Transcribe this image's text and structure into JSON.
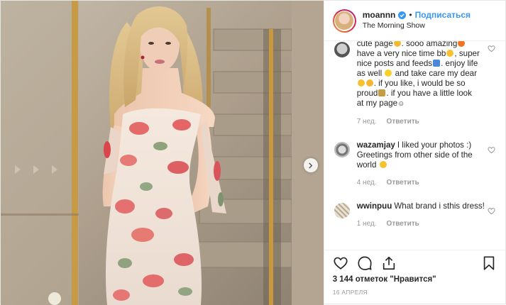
{
  "header": {
    "username": "moannn",
    "follow_label": "Подписаться",
    "location": "The Morning Show",
    "verified_icon": "verified-badge-icon"
  },
  "comments": [
    {
      "text_top": "cute page",
      "text_top_b": ". sooo amazing",
      "line2a": "have a very nice time bb",
      "line2b": ", super",
      "line3a": "nice posts and feeds",
      "line3b": ". enjoy life",
      "line4a": "as well",
      "line4b": "and take care my dear",
      "line5": ". if you like, i would be so",
      "line6a": "proud",
      "line6b": ". if you have a little look",
      "line7": "at my page",
      "time": "7 нед.",
      "reply": "Ответить"
    },
    {
      "user": "wazamjay",
      "text": "I liked your photos :) Greetings from other side of the world",
      "time": "4 нед.",
      "reply": "Ответить"
    },
    {
      "user": "wwinpuu",
      "text": "What brand i sthis dress!",
      "time": "1 нед.",
      "reply": "Ответить"
    }
  ],
  "actions": {
    "icons": [
      "heart-icon",
      "comment-icon",
      "share-icon",
      "bookmark-icon"
    ]
  },
  "likes": {
    "count_text": "3 144 отметок",
    "like_link": "\"Нравится\""
  },
  "date": "16 АПРЕЛЯ",
  "colors": {
    "follow": "#3897f0",
    "muted": "#999999",
    "text": "#262626"
  }
}
